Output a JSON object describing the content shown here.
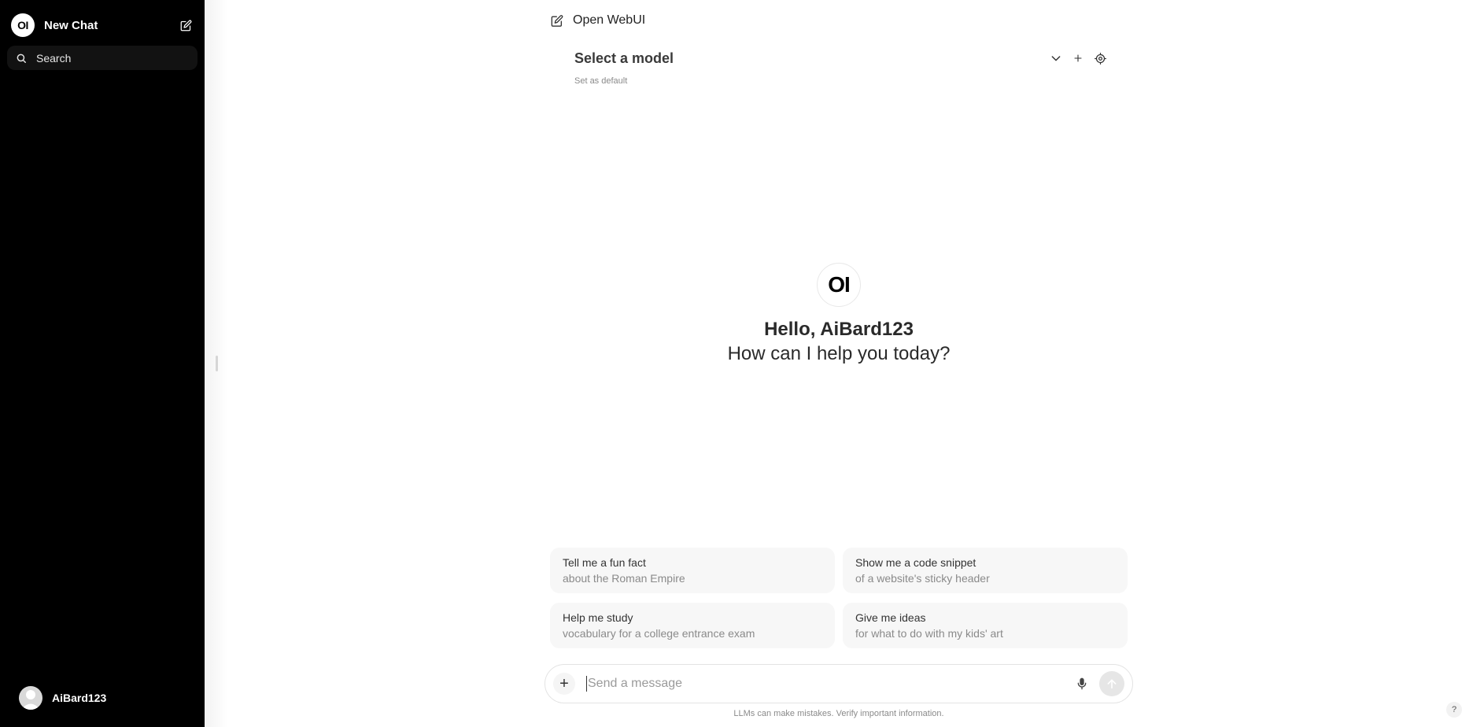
{
  "sidebar": {
    "logo_text": "OI",
    "new_chat_label": "New Chat",
    "search_label": "Search",
    "user_name": "AiBard123"
  },
  "header": {
    "title": "Open WebUI",
    "model_select_label": "Select a model",
    "set_default_label": "Set as default"
  },
  "welcome": {
    "logo_text": "OI",
    "greeting": "Hello, AiBard123",
    "prompt": "How can I help you today?"
  },
  "suggestions": [
    {
      "title": "Tell me a fun fact",
      "subtitle": "about the Roman Empire"
    },
    {
      "title": "Show me a code snippet",
      "subtitle": "of a website's sticky header"
    },
    {
      "title": "Help me study",
      "subtitle": "vocabulary for a college entrance exam"
    },
    {
      "title": "Give me ideas",
      "subtitle": "for what to do with my kids' art"
    }
  ],
  "composer": {
    "placeholder": "Send a message",
    "plus_label": "+",
    "disclaimer": "LLMs can make mistakes. Verify important information.",
    "help_label": "?"
  },
  "icons": {
    "new_chat": "edit-icon",
    "search": "search-icon",
    "model_dropdown": "chevron-down-icon",
    "add_model": "plus-icon",
    "model_settings": "gear-icon",
    "mic": "mic-icon",
    "send": "arrow-up-icon"
  }
}
